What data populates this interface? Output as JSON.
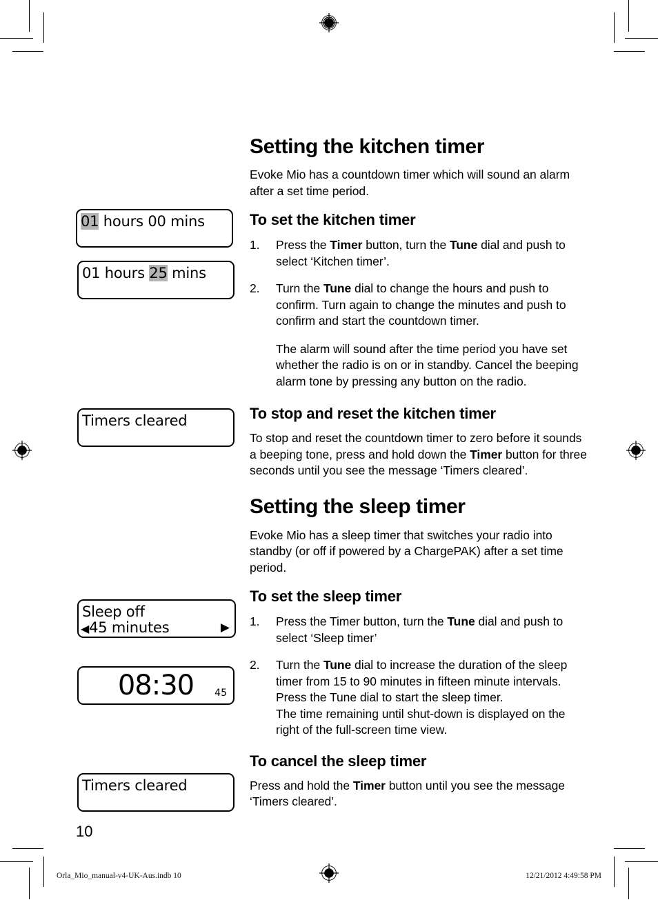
{
  "page": {
    "number": "10",
    "footer_left": "Orla_Mio_manual-v4-UK-Aus.indb   10",
    "footer_right": "12/21/2012   4:49:58 PM"
  },
  "colors": {
    "ink": "#000000",
    "lcd_highlight": "#b4b4b4",
    "page_background": "#ffffff"
  },
  "screens": {
    "hours_selected": {
      "highlight": "01",
      "rest": " hours 00 mins"
    },
    "minutes_selected": {
      "before": "01 hours ",
      "highlight": "25",
      "after": " mins"
    },
    "timers_cleared_top": {
      "line1": "Timers cleared"
    },
    "sleep_off": {
      "line1": "Sleep off",
      "arrow_left": "◀",
      "line2": "45 minutes",
      "arrow_right": "▶"
    },
    "clock": {
      "time": "08:30",
      "sleep_remaining": "45"
    },
    "timers_cleared_bottom": {
      "line1": "Timers cleared"
    }
  },
  "content": {
    "kitchen": {
      "heading": "Setting the kitchen timer",
      "intro": "Evoke Mio has a countdown timer which will sound an alarm after a set time period.",
      "set_heading": "To set the kitchen timer",
      "step1": {
        "num": "1.",
        "a": "Press the ",
        "b1": "Timer",
        "c": " button,  turn the ",
        "b2": "Tune",
        "d": " dial and push to select ‘Kitchen timer’."
      },
      "step2": {
        "num": "2.",
        "a": "Turn the ",
        "b1": "Tune",
        "c": " dial to change the hours and push to confirm. Turn again to change the minutes and push to confirm and start the countdown timer."
      },
      "step2_note": "The alarm will sound after the time period you have set whether the radio is on or in standby. Cancel the beeping alarm tone by pressing any button on the radio.",
      "stop_heading": "To stop and reset the kitchen timer",
      "stop_body": {
        "a": "To stop and reset the countdown timer to zero before it sounds a beeping tone, press and hold down the ",
        "b1": "Timer",
        "c": " button for three seconds until you see the message ‘Timers cleared’."
      }
    },
    "sleep": {
      "heading": "Setting the sleep timer",
      "intro": "Evoke Mio has a sleep timer that switches your radio into standby (or off if powered by a ChargePAK) after a set time period.",
      "set_heading": "To set the sleep timer",
      "step1": {
        "num": "1.",
        "a": "Press the Timer button, turn the ",
        "b1": "Tune",
        "c": " dial and push to select ‘Sleep timer’"
      },
      "step2": {
        "num": "2.",
        "a": "Turn the ",
        "b1": "Tune",
        "c": " dial to increase the duration of the sleep timer from 15 to 90 minutes in fifteen minute intervals. Press the Tune dial to start the sleep timer.",
        "d": "The time remaining until shut-down is displayed on the right of the full-screen time view."
      },
      "cancel_heading": "To cancel the sleep timer",
      "cancel_body": {
        "a": "Press and hold the ",
        "b1": "Timer",
        "c": " button until you see the message ‘Timers cleared’."
      }
    }
  }
}
